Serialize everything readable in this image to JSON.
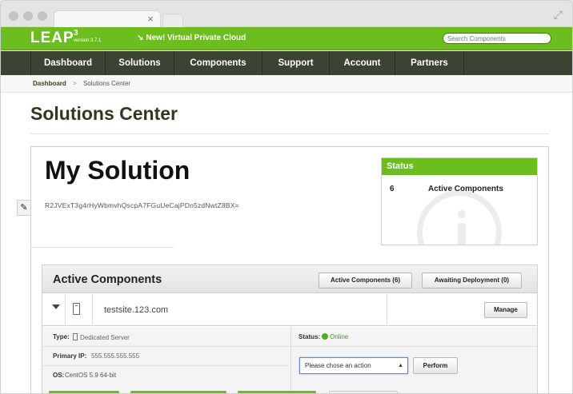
{
  "browser": {
    "tab_close": "×",
    "expand": "⤢"
  },
  "header": {
    "logo": "LEAP",
    "logo_sup": "3",
    "version": "version 3.7.1",
    "promo": "New! Virtual Private Cloud",
    "search_placeholder": "Search Components"
  },
  "nav": {
    "items": [
      {
        "label": "Dashboard"
      },
      {
        "label": "Solutions"
      },
      {
        "label": "Components"
      },
      {
        "label": "Support"
      },
      {
        "label": "Account"
      },
      {
        "label": "Partners"
      }
    ]
  },
  "breadcrumb": {
    "parent": "Dashboard",
    "separator": ">",
    "current": "Solutions Center"
  },
  "page": {
    "title": "Solutions Center"
  },
  "solution": {
    "name": "My Solution",
    "hash": "R2JVExT3g4rHyWbmvhQscpA7FGuUeCajPDn5zdNwtZ8BX="
  },
  "status": {
    "heading": "Status",
    "count": "6",
    "label": "Active Components"
  },
  "components": {
    "heading": "Active Components",
    "active_btn": "Active Components (6)",
    "awaiting_btn": "Awaiting Deployment (0)",
    "row": {
      "hostname": "testsite.123.com",
      "manage_btn": "Manage",
      "type_label": "Type:",
      "type_value": "Dedicated Server",
      "ip_label": "Primary IP:",
      "ip_value": "555.555.555.555",
      "os_label": "OS:",
      "os_value": "CentOS 5.9 64-bit",
      "status_label": "Status:",
      "status_value": "Online",
      "action_placeholder": "Please chose an action",
      "perform_btn": "Perform"
    }
  },
  "colors": {
    "brand_green": "#6cbe1e",
    "nav_dark": "#3b4333",
    "online_green": "#48b21d"
  }
}
